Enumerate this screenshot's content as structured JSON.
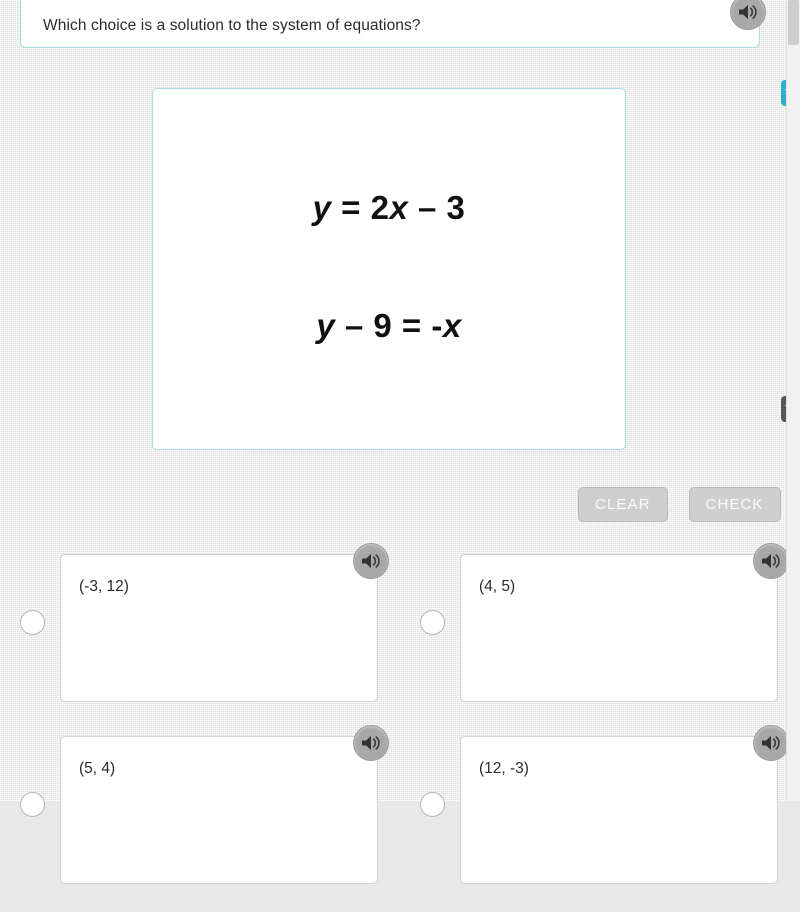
{
  "question": {
    "text": "Which choice is a solution to the system of equations?",
    "speaker_icon": "speaker-icon"
  },
  "equations": {
    "line1": {
      "parts": [
        {
          "text": "y",
          "italic": true
        },
        {
          "text": " = 2",
          "italic": false
        },
        {
          "text": "x",
          "italic": true
        },
        {
          "text": " – 3",
          "italic": false
        }
      ],
      "plain": "y = 2x – 3"
    },
    "line2": {
      "parts": [
        {
          "text": "y",
          "italic": true
        },
        {
          "text": " – 9 = -",
          "italic": false
        },
        {
          "text": "x",
          "italic": true
        }
      ],
      "plain": "y – 9 = -x"
    }
  },
  "actions": {
    "clear_label": "CLEAR",
    "check_label": "CHECK",
    "disabled": true
  },
  "choices": [
    {
      "label": "(-3, 12)",
      "selected": false,
      "speaker_icon": "speaker-icon"
    },
    {
      "label": "(4, 5)",
      "selected": false,
      "speaker_icon": "speaker-icon"
    },
    {
      "label": "(5, 4)",
      "selected": false,
      "speaker_icon": "speaker-icon"
    },
    {
      "label": "(12, -3)",
      "selected": false,
      "speaker_icon": "speaker-icon"
    }
  ],
  "edge_tabs": [
    {
      "icon": "triangle-down-icon",
      "color": "#2bb3cc"
    },
    {
      "icon": "triangle-down-icon",
      "color": "#555758"
    }
  ],
  "colors": {
    "accent_teal": "#2bb3cc",
    "card_border_teal": "#a9dce2",
    "page_background": "#e9e9e9",
    "button_disabled": "#cfcfcf"
  }
}
